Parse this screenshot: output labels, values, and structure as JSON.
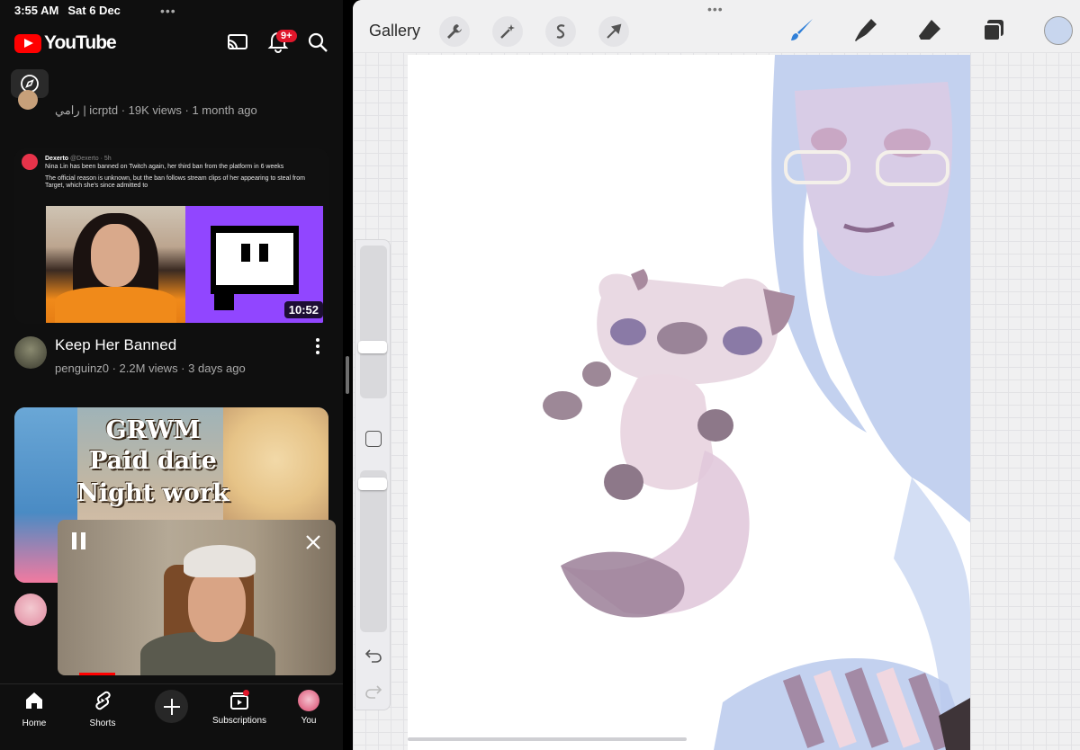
{
  "status_bar": {
    "time": "3:55 AM",
    "date": "Sat 6 Dec"
  },
  "youtube": {
    "logo_text": "YouTube",
    "notification_count": "9+",
    "prev_video_meta": "رامي | icrptd · 19K views · 1 month ago",
    "video1": {
      "tweet_author": "Dexerto",
      "tweet_handle": "@Dexerto · 5h",
      "tweet_line1": "Nina Lin has been banned on Twitch again, her third ban from the platform in 6 weeks",
      "tweet_line2": "The official reason is unknown, but the ban follows stream clips of her appearing to steal from Target, which she's since admitted to",
      "duration": "10:52",
      "title": "Keep Her Banned",
      "meta": "penguinz0 · 2.2M views · 3 days ago"
    },
    "video2": {
      "thumb_line1": "GRWM",
      "thumb_line2": "Paid date",
      "thumb_line3": "Night work"
    },
    "nav": {
      "home": "Home",
      "shorts": "Shorts",
      "subscriptions": "Subscriptions",
      "you": "You"
    },
    "colors": {
      "brand_red": "#ff0000",
      "badge_red": "#e0172b"
    }
  },
  "procreate": {
    "gallery_label": "Gallery",
    "tools_left": [
      "wrench-icon",
      "magic-wand-icon",
      "selection-icon",
      "transform-arrow-icon"
    ],
    "tools_right": [
      "brush-icon",
      "smudge-icon",
      "eraser-icon",
      "layers-icon"
    ],
    "current_color": "#c8d6ee",
    "brush_color": "#2f7fd8"
  }
}
